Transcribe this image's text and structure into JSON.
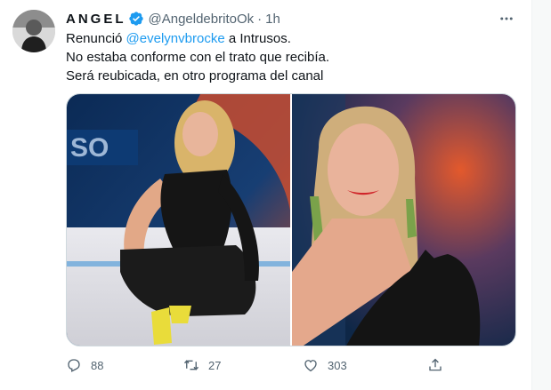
{
  "author": {
    "display_name": "ANGEL",
    "handle": "@AngeldebritoOk",
    "separator": "·",
    "time": "1h"
  },
  "tweet": {
    "line1_prefix": "Renunció ",
    "line1_mention": "@evelynvbrocke",
    "line1_suffix": " a Intrusos.",
    "line2": "No estaba conforme con el trato que recibía.",
    "line3": "Será reubicada, en otro programa del canal"
  },
  "actions": {
    "replies": "88",
    "retweets": "27",
    "likes": "303"
  },
  "colors": {
    "accent": "#1d9bf0",
    "secondary_text": "#536471",
    "primary_text": "#0f1419"
  },
  "icons": [
    "verified-badge-icon",
    "more-icon",
    "reply-icon",
    "retweet-icon",
    "like-icon",
    "share-icon"
  ]
}
